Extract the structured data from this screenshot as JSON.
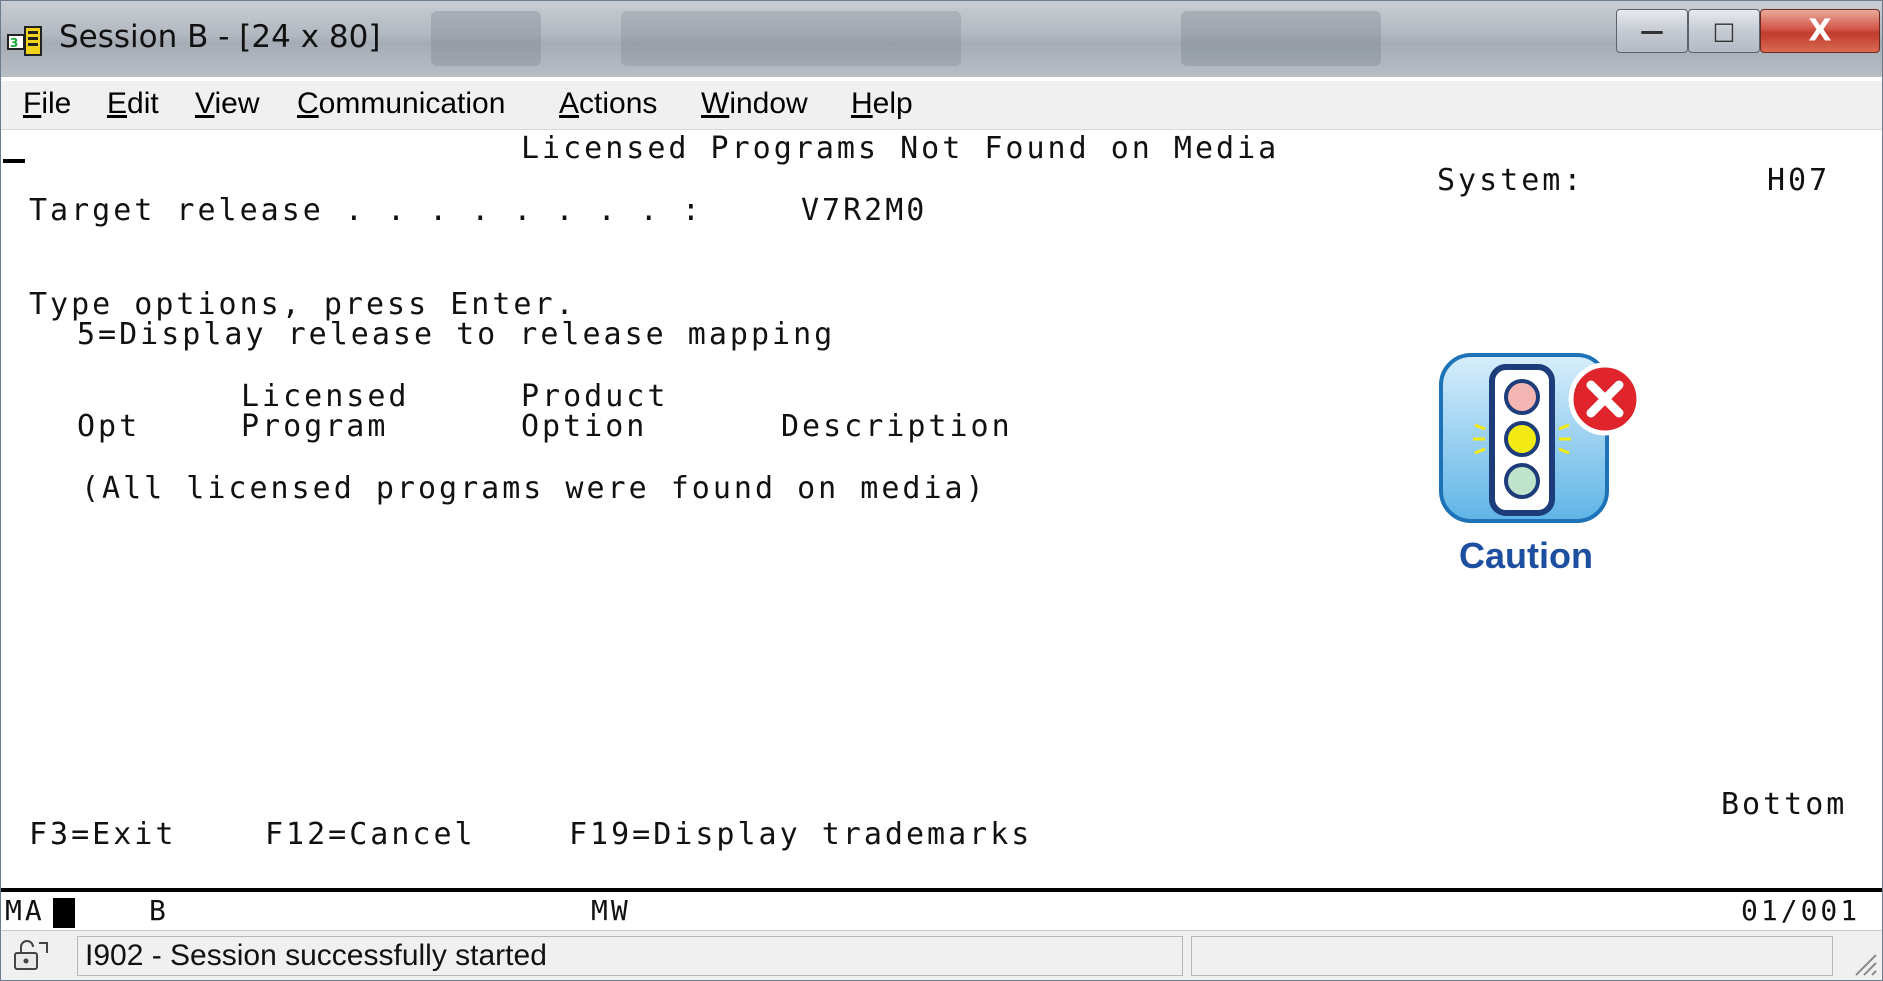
{
  "window": {
    "title": "Session B - [24 x 80]",
    "controls": {
      "minimize": "—",
      "maximize": "□",
      "close": "X"
    }
  },
  "menu": {
    "items": [
      {
        "label_first": "F",
        "label_rest": "ile"
      },
      {
        "label_first": "E",
        "label_rest": "dit"
      },
      {
        "label_first": "V",
        "label_rest": "iew"
      },
      {
        "label_first": "C",
        "label_rest": "ommunication"
      },
      {
        "label_first": "A",
        "label_rest": "ctions"
      },
      {
        "label_first": "W",
        "label_rest": "indow"
      },
      {
        "label_first": "H",
        "label_rest": "elp"
      }
    ]
  },
  "screen": {
    "heading": "Licensed Programs Not Found on Media",
    "system_label": "System:",
    "system_value": "H07",
    "target_release_label": "Target release . . . . . . . . :",
    "target_release_value": "V7R2M0",
    "instructions": "Type options, press Enter.",
    "option_5": "5=Display release to release mapping",
    "col_licensed": "Licensed",
    "col_product": "Product",
    "col_opt": "Opt",
    "col_program": "Program",
    "col_option": "Option",
    "col_description": "Description",
    "empty_message": "(All licensed programs were found on media)",
    "bottom_marker": "Bottom",
    "fkeys": {
      "f3": "F3=Exit",
      "f12": "F12=Cancel",
      "f19": "F19=Display trademarks"
    },
    "caution_label": "Caution"
  },
  "oia": {
    "ma": "MA",
    "session": "B",
    "mw": "MW",
    "cursor_position": "01/001"
  },
  "status": {
    "message": "I902 - Session successfully started"
  },
  "colors": {
    "caution_blue": "#1d4fa0",
    "close_red": "#d2574a"
  }
}
